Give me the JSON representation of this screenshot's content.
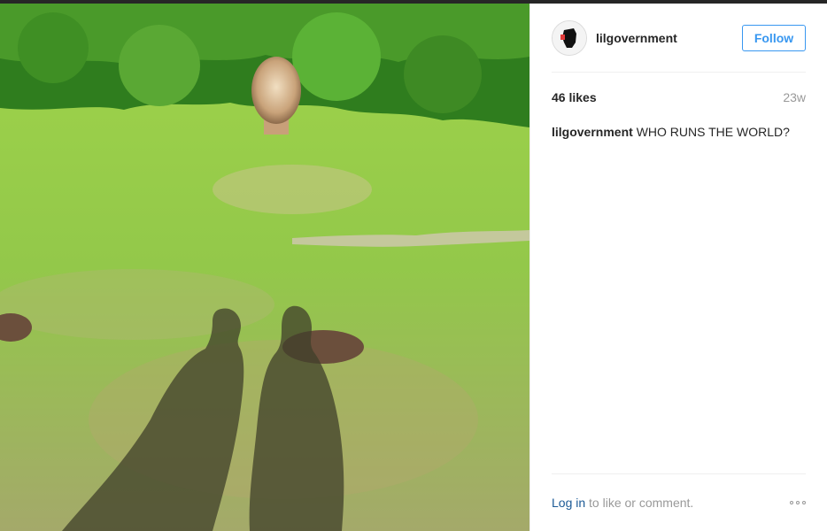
{
  "post": {
    "username": "lilgovernment",
    "follow_label": "Follow",
    "likes": "46 likes",
    "age": "23w",
    "caption": {
      "username": "lilgovernment",
      "text": "WHO RUNS THE WORLD?"
    },
    "footer": {
      "login_label": "Log in",
      "login_suffix": " to like or comment."
    },
    "more_icon": "ellipsis-icon"
  },
  "colors": {
    "accent": "#3897f0",
    "grass": "#8cc63f",
    "trees": "#2f7d1e"
  }
}
